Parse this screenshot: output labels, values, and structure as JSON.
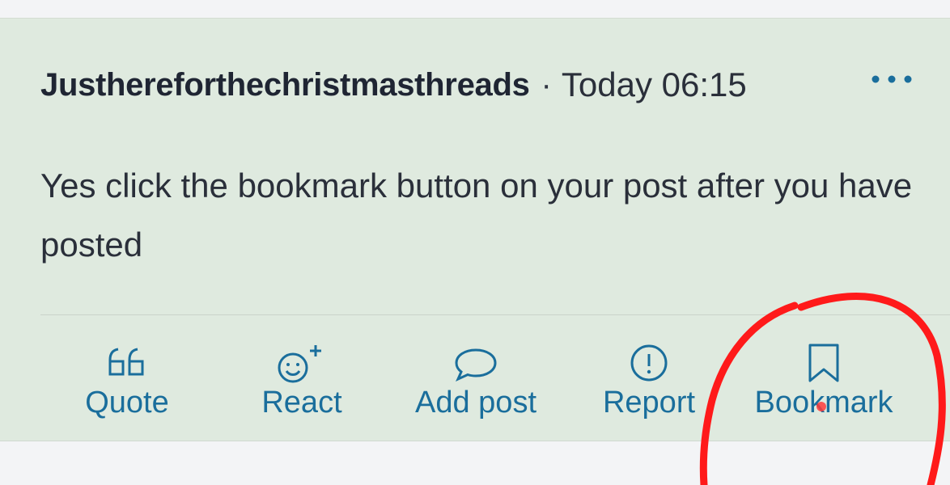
{
  "post": {
    "username": "Justhereforthechristmasthreads",
    "separator": "·",
    "timestamp": "Today 06:15",
    "body": "Yes click the bookmark button on your post after you have posted"
  },
  "actions": {
    "quote": {
      "label": "Quote",
      "icon": "quote-icon"
    },
    "react": {
      "label": "React",
      "icon": "smiley-plus-icon"
    },
    "add_post": {
      "label": "Add post",
      "icon": "speech-bubble-icon"
    },
    "report": {
      "label": "Report",
      "icon": "exclamation-circle-icon"
    },
    "bookmark": {
      "label": "Bookmark",
      "icon": "bookmark-icon"
    }
  },
  "colors": {
    "card_background": "#dfeadf",
    "page_background": "#f3f4f6",
    "action_blue": "#1a6e9c",
    "annotation_red": "#ff1a1a"
  }
}
